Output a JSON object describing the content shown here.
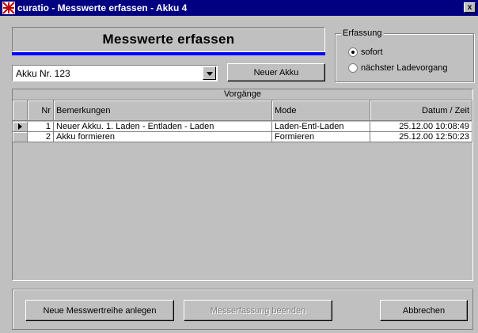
{
  "window": {
    "title": "curatio - Messwerte erfassen - Akku 4",
    "close_label": "x"
  },
  "header": {
    "panel_title": "Messwerte erfassen"
  },
  "erfassung": {
    "title": "Erfassung",
    "options": [
      {
        "label": "sofort",
        "checked": true
      },
      {
        "label": "nächster Ladevorgang",
        "checked": false
      }
    ]
  },
  "akku_select": {
    "value": "Akku Nr. 123"
  },
  "buttons": {
    "neuer_akku": "Neuer Akku",
    "neue_messwertreihe": "Neue Messwertreihe anlegen",
    "messerfassung_beenden": "Messerfassung beenden",
    "abbrechen": "Abbrechen"
  },
  "table": {
    "caption": "Vorgänge",
    "columns": [
      "Nr",
      "Bemerkungen",
      "Mode",
      "Datum / Zeit"
    ],
    "rows": [
      {
        "nr": "1",
        "bemerkungen": "Neuer Akku. 1. Laden - Entladen - Laden",
        "mode": "Laden-Entl-Laden",
        "datum": "25.12.00 10:08:49",
        "current": true
      },
      {
        "nr": "2",
        "bemerkungen": "Akku formieren",
        "mode": "Formieren",
        "datum": "25.12.00 12:50:23",
        "current": false
      }
    ]
  }
}
